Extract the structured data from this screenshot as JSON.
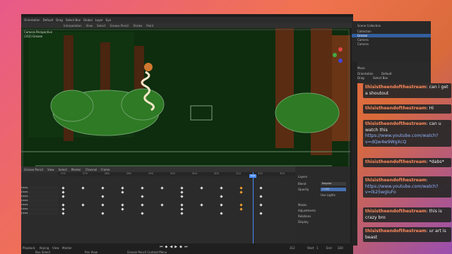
{
  "app": {
    "topbar": [
      "Orientation",
      "Default",
      "Drag",
      "Select Box",
      "Global",
      "Layer",
      "Eye"
    ],
    "header_menus": [
      "Interpolation",
      "View",
      "Select",
      "Grease Pencil",
      "Stroke",
      "Paint"
    ]
  },
  "viewport": {
    "camera_label": "Camera Perspective",
    "object_label": "(312) Grease"
  },
  "sidebar_left": {
    "mode": "Move"
  },
  "outliner": {
    "title": "Scene Collection",
    "items": [
      {
        "label": "Collection",
        "active": false
      },
      {
        "label": "Grease",
        "active": true
      },
      {
        "label": "Camera",
        "active": false
      },
      {
        "label": "Camera",
        "active": false
      }
    ]
  },
  "properties": {
    "section": "Move",
    "orientation_label": "Orientation",
    "orientation_value": "Default",
    "drag_label": "Drag",
    "drag_value": "Select Box"
  },
  "chat": [
    {
      "user": "thisistheendofthestream",
      "parts": [
        ": can i get a shoutout"
      ]
    },
    {
      "user": "thisistheendofthestream",
      "parts": [
        ": Hi"
      ]
    },
    {
      "user": "thisistheendofthestream",
      "parts": [
        ": can u watch this"
      ],
      "link": "https://www.youtube.com/watch?v=dQw4w9WgXcQ"
    },
    {
      "user": "thisistheendofthestream",
      "parts": [
        ": *dabs*"
      ]
    },
    {
      "user": "thisistheendofthestream",
      "parts": [
        ":"
      ],
      "link": "https://www.youtube.com/watch?v=lk25wgluFo"
    },
    {
      "user": "thisistheendofthestream",
      "parts": [
        ": this is crazy bro"
      ]
    },
    {
      "user": "thisistheendofthestream",
      "parts": [
        ": ur art is beast"
      ]
    }
  ],
  "dopesheet": {
    "mode": "Grease Pencil",
    "menus": [
      "View",
      "Select",
      "Marker",
      "Channel",
      "Frame"
    ],
    "ruler": [
      "270",
      "275",
      "280",
      "285",
      "290",
      "295",
      "300",
      "305",
      "310",
      "315",
      "320"
    ],
    "current_frame": "312",
    "channels": [
      "Lines",
      "Lines",
      "Lines",
      "Lines",
      "Lines",
      "Lines",
      "Lines"
    ]
  },
  "layer_panel": {
    "title": "Layers",
    "blend_label": "Blend",
    "blend_value": "Regular",
    "opacity_label": "Opacity",
    "opacity_value": "1.000",
    "use_lights": "Use Lights",
    "sections": [
      "Masks",
      "Adjustments",
      "Relations",
      "Display"
    ]
  },
  "statusbar": {
    "items": [
      "Playback",
      "Keying",
      "View",
      "Marker"
    ],
    "start_label": "Start",
    "start_value": "1",
    "end_label": "End",
    "end_value": "320",
    "frame_value": "312",
    "hints": [
      "Box Select",
      "Pan View",
      "Grease Pencil Context Menu"
    ]
  }
}
